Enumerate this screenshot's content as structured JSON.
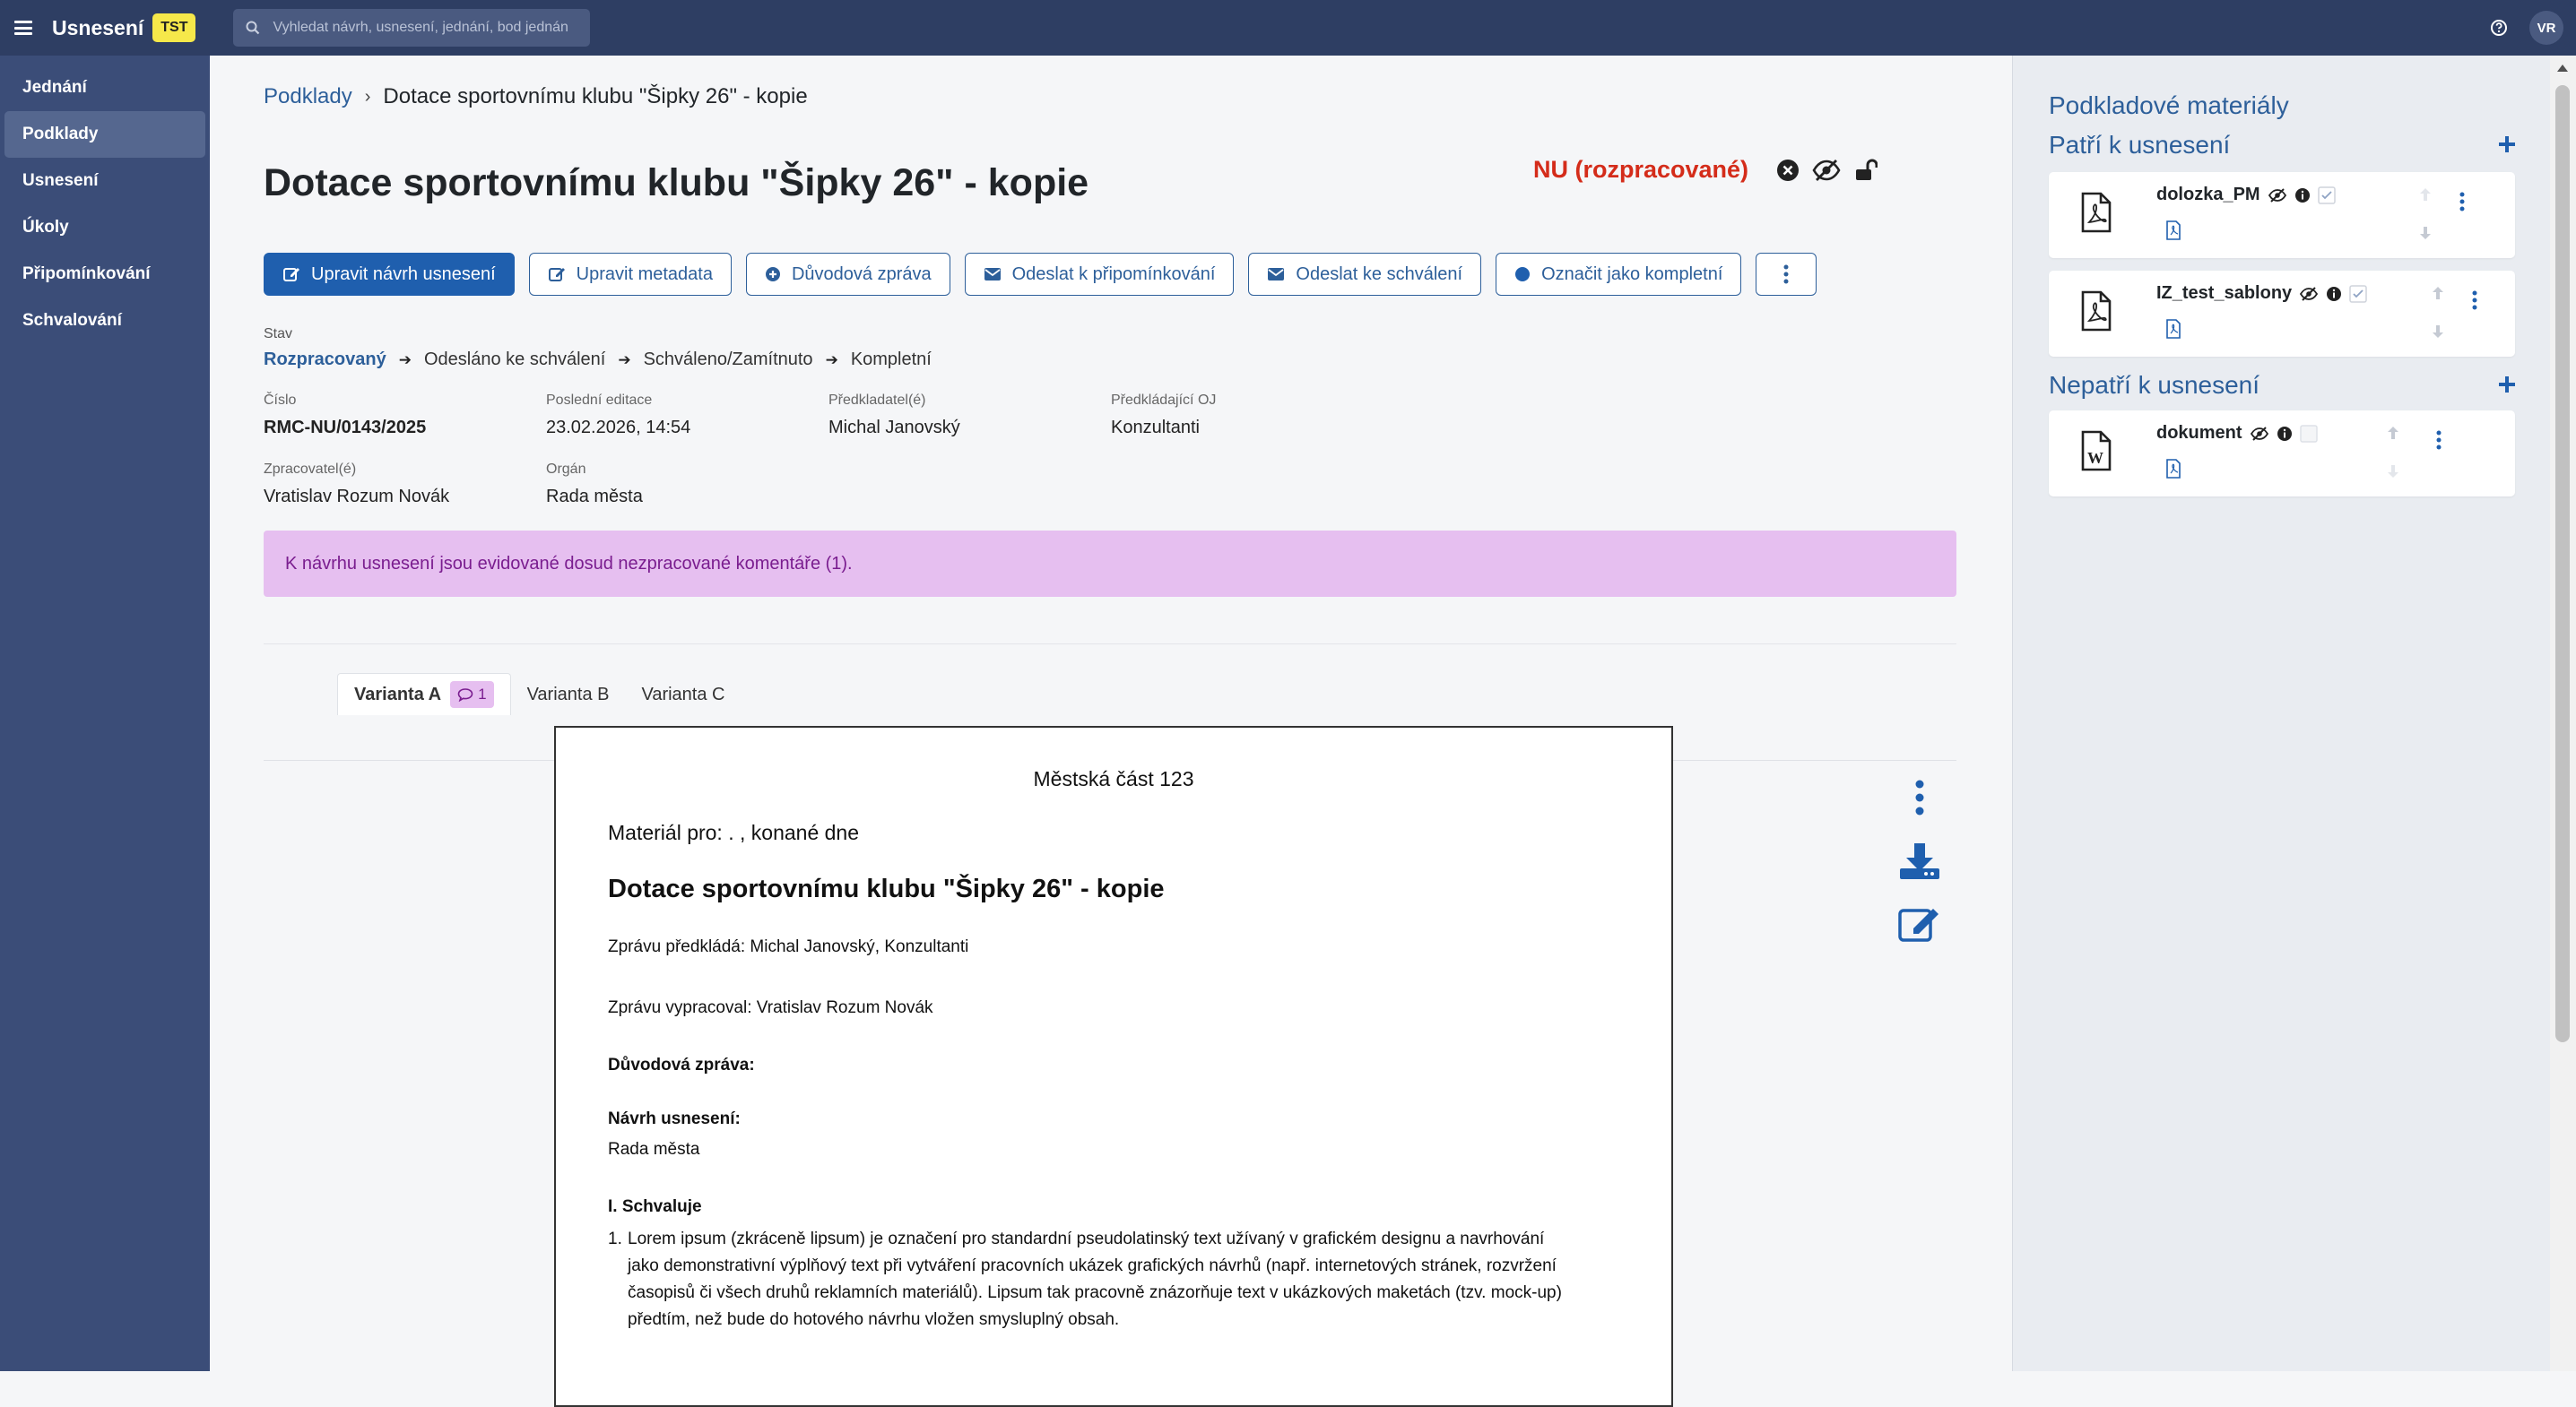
{
  "topbar": {
    "app_title": "Usnesení",
    "env_badge": "TST",
    "search_placeholder": "Vyhledat návrh, usnesení, jednání, bod jednání",
    "avatar_initials": "VR"
  },
  "sidebar": {
    "items": [
      {
        "label": "Jednání"
      },
      {
        "label": "Podklady"
      },
      {
        "label": "Usnesení"
      },
      {
        "label": "Úkoly"
      },
      {
        "label": "Připomínkování"
      },
      {
        "label": "Schvalování"
      }
    ],
    "active": "Podklady"
  },
  "breadcrumb": {
    "parent": "Podklady",
    "current": "Dotace sportovnímu klubu \"Šipky 26\" - kopie"
  },
  "page": {
    "title": "Dotace sportovnímu klubu \"Šipky 26\" - kopie",
    "status_label": "NU (rozpracované)"
  },
  "toolbar": {
    "edit_proposal": "Upravit návrh usnesení",
    "edit_metadata": "Upravit metadata",
    "reason_report": "Důvodová zpráva",
    "send_comments": "Odeslat k připomínkování",
    "send_approval": "Odeslat ke schválení",
    "mark_complete": "Označit jako kompletní"
  },
  "state": {
    "label": "Stav",
    "steps": [
      "Rozpracovaný",
      "Odesláno ke schválení",
      "Schváleno/Zamítnuto",
      "Kompletní"
    ]
  },
  "meta": {
    "number_label": "Číslo",
    "number_value": "RMC-NU/0143/2025",
    "last_edit_label": "Poslední editace",
    "last_edit_value": "23.02.2026, 14:54",
    "submitter_label": "Předkladatel(é)",
    "submitter_value": "Michal Janovský",
    "org_unit_label": "Předkládající OJ",
    "org_unit_value": "Konzultanti",
    "processor_label": "Zpracovatel(é)",
    "processor_value": "Vratislav Rozum Novák",
    "body_label": "Orgán",
    "body_value": "Rada města"
  },
  "alert": {
    "text": "K návrhu usnesení jsou evidované dosud nezpracované komentáře (1)."
  },
  "tabs": [
    {
      "label": "Varianta A",
      "badge": "1"
    },
    {
      "label": "Varianta B"
    },
    {
      "label": "Varianta C"
    }
  ],
  "document": {
    "header": "Městská část 123",
    "material_for": "Materiál pro: . , konané dne",
    "title": "Dotace sportovnímu klubu \"Šipky 26\" - kopie",
    "submitted_by": "Zprávu předkládá: Michal Janovský, Konzultanti",
    "prepared_by": "Zprávu vypracoval: Vratislav Rozum Novák",
    "reason_heading": "Důvodová zpráva:",
    "proposal_heading": "Návrh usnesení:",
    "body": "Rada města",
    "section_heading": "I. Schvaluje",
    "item_number": "1.",
    "item_lines": [
      "Lorem ipsum (zkráceně lipsum) je označení pro standardní pseudolatinský text užívaný v grafickém designu a navrhování",
      "jako demonstrativní výplňový text při vytváření pracovních ukázek grafických návrhů (např. internetových stránek, rozvržení",
      "časopisů či všech druhů reklamních materiálů). Lipsum tak pracovně znázorňuje text v ukázkových maketách (tzv. mock-up)",
      "předtím, než bude do hotového návrhu vložen smysluplný obsah."
    ]
  },
  "right_panel": {
    "title": "Podkladové materiály",
    "belongs_heading": "Patří k usnesení",
    "not_belongs_heading": "Nepatří k usnesení",
    "files": [
      {
        "name": "dolozka_PM",
        "type": "pdf",
        "checked": true
      },
      {
        "name": "IZ_test_sablony",
        "type": "pdf",
        "checked": true
      },
      {
        "name": "dokument",
        "type": "word",
        "checked": false
      }
    ]
  },
  "colors": {
    "topbar": "#2e3e63",
    "sidebar": "#3b4d78",
    "accent": "#1f5fae",
    "status_red": "#d42c1a",
    "alert_bg": "#e6bff0"
  }
}
